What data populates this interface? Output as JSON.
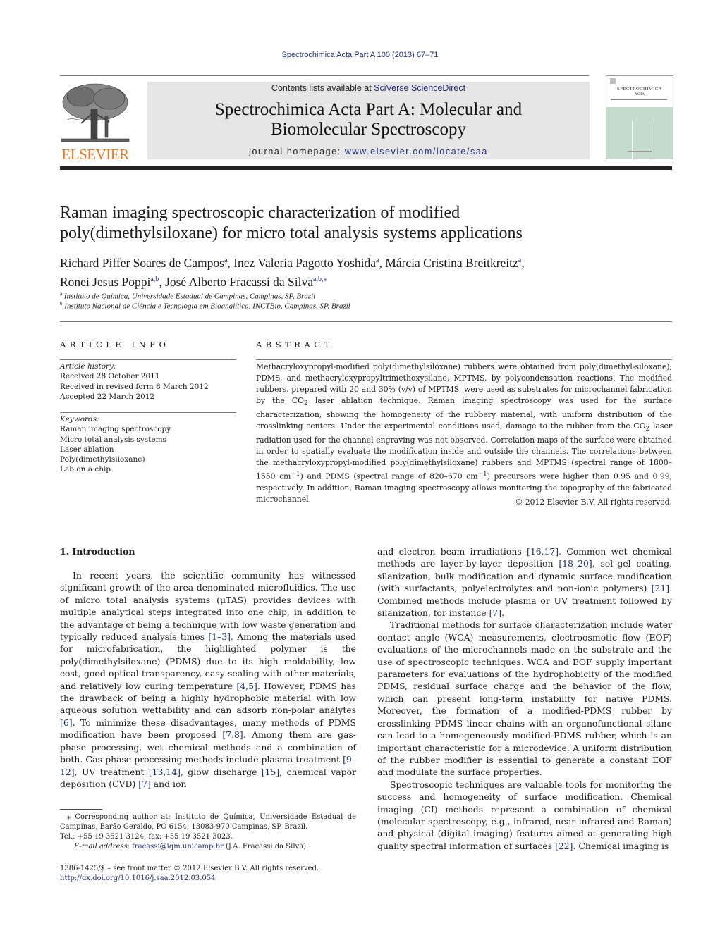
{
  "header": {
    "running_head": "Spectrochimica Acta Part A 100 (2013) 67–71",
    "contents_prefix": "Contents lists available at ",
    "contents_link": "SciVerse ScienceDirect",
    "journal_title_line1": "Spectrochimica Acta Part A: Molecular and",
    "journal_title_line2": "Biomolecular Spectroscopy",
    "homepage_prefix": "journal homepage: ",
    "homepage_link": "www.elsevier.com/locate/saa",
    "publisher_logo_text": "ELSEVIER",
    "cover_title": "SPECTROCHIMICA",
    "cover_subtitle": "ACTA",
    "publisher_color": "#e87722",
    "link_color": "#1f2d7a",
    "cover_color": "#c4dccb"
  },
  "article": {
    "title_line1": "Raman imaging spectroscopic characterization of modified",
    "title_line2": "poly(dimethylsiloxane) for micro total analysis systems applications",
    "authors": [
      {
        "name": "Richard Piffer Soares de Campos",
        "affil": "a",
        "sep": ", "
      },
      {
        "name": "Inez Valeria Pagotto Yoshida",
        "affil": "a",
        "sep": ", "
      },
      {
        "name": "Márcia Cristina Breitkreitz",
        "affil": "a",
        "sep": ","
      },
      {
        "name": "Ronei Jesus Poppi",
        "affil": "a,b",
        "sep": ", "
      },
      {
        "name": "José Alberto Fracassi da Silva",
        "affil": "a,b,⁎",
        "sep": ""
      }
    ],
    "affiliations": [
      {
        "mark": "a",
        "text": "Instituto de Química, Universidade Estadual de Campinas, Campinas, SP, Brazil"
      },
      {
        "mark": "b",
        "text": "Instituto Nacional de Ciência e Tecnologia em Bioanalítica, INCTBio, Campinas, SP, Brazil"
      }
    ]
  },
  "article_info": {
    "heading": "ARTICLE INFO",
    "history_label": "Article history:",
    "history": [
      "Received 28 October 2011",
      "Received in revised form 8 March 2012",
      "Accepted 22 March 2012"
    ],
    "keywords_label": "Keywords:",
    "keywords": [
      "Raman imaging spectroscopy",
      "Micro total analysis systems",
      "Laser ablation",
      "Poly(dimethylsiloxane)",
      "Lab on a chip"
    ]
  },
  "abstract": {
    "heading": "ABSTRACT",
    "p1": "Methacryloxypropyl-modified poly(dimethylsiloxane) rubbers were obtained from poly(dimethyl-siloxane), PDMS, and methacryloxypropyltrimethoxysilane, MPTMS, by polycondensation reactions. The modified rubbers, prepared with 20 and 30% (v/v) of MPTMS, were used as substrates for microchannel fabrication by the CO",
    "p2": " laser ablation technique. Raman imaging spectroscopy was used for the surface characterization, showing the homogeneity of the rubbery material, with uniform distribution of the crosslinking centers. Under the experimental conditions used, damage to the rubber from the CO",
    "p3": " laser radiation used for the channel engraving was not observed. Correlation maps of the surface were obtained in order to spatially evaluate the modification inside and outside the channels. The correlations between the methacryloxypropyl-modified poly(dimethylsiloxane) rubbers and MPTMS (spectral range of 1800–1550 cm",
    "p4": ") and PDMS (spectral range of 820–670 cm",
    "p5": ") precursors were higher than 0.95 and 0.99, respectively. In addition, Raman imaging spectroscopy allows monitoring the topography of the fabricated microchannel.",
    "sub2": "2",
    "sup_minus1": "−1",
    "copyright": "© 2012 Elsevier B.V. All rights reserved."
  },
  "intro": {
    "heading": "1.  Introduction",
    "left_p1_a": "In recent years, the scientific community has witnessed significant growth of the area denominated microfluidics. The use of micro total analysis systems (μTAS) provides devices with multiple analytical steps integrated into one chip, in addition to the advantage of being a technique with low waste generation and typically reduced analysis times ",
    "ref_1_3": "[1–3]",
    "left_p1_b": ". Among the materials used for microfabrication, the highlighted polymer is the poly(dimethylsiloxane) (PDMS) due to its high moldability, low cost, good optical transparency, easy sealing with other materials, and relatively low curing temperature ",
    "ref_4_5": "[4,5]",
    "left_p1_c": ". However, PDMS has the drawback of being a highly hydrophobic material with low aqueous solution wettability and can adsorb non-polar analytes ",
    "ref_6": "[6]",
    "left_p1_d": ". To minimize these disadvantages, many methods of PDMS modification have been proposed ",
    "ref_7_8": "[7,8]",
    "left_p1_e": ". Among them are gas-phase processing, wet chemical methods and a combination of both. Gas-phase processing methods include plasma treatment ",
    "ref_9_12": "[9–12]",
    "left_p1_f": ", UV treatment ",
    "ref_13_14": "[13,14]",
    "left_p1_g": ", glow discharge ",
    "ref_15": "[15]",
    "left_p1_h": ", chemical vapor deposition (CVD) ",
    "ref_7": "[7]",
    "left_p1_i": " and ion",
    "right_p1_a": "and electron beam irradiations ",
    "ref_16_17": "[16,17]",
    "right_p1_b": ". Common wet chemical methods are layer-by-layer deposition ",
    "ref_18_20": "[18–20]",
    "right_p1_c": ", sol–gel coating, silanization, bulk modification and dynamic surface modification (with surfactants, polyelectrolytes and non-ionic polymers) ",
    "ref_21": "[21]",
    "right_p1_d": ". Combined methods include plasma or UV treatment followed by silanization, for instance ",
    "ref_7b": "[7]",
    "right_p1_e": ".",
    "right_p2": "Traditional methods for surface characterization include water contact angle (WCA) measurements, electroosmotic flow (EOF) evaluations of the microchannels made on the substrate and the use of spectroscopic techniques. WCA and EOF supply important parameters for evaluations of the hydrophobicity of the modified PDMS, residual surface charge and the behavior of the flow, which can present long-term instability for native PDMS. Moreover, the formation of a modified-PDMS rubber by crosslinking PDMS linear chains with an organofunctional silane can lead to a homogeneously modified-PDMS rubber, which is an important characteristic for a microdevice. A uniform distribution of the rubber modifier is essential to generate a constant EOF and modulate the surface properties.",
    "right_p3_a": "Spectroscopic techniques are valuable tools for monitoring the success and homogeneity of surface modification. Chemical imaging (CI) methods represent a combination of chemical (molecular spectroscopy, e.g., infrared, near infrared and Raman) and physical (digital imaging) features aimed at generating high quality spectral information of surfaces ",
    "ref_22": "[22]",
    "right_p3_b": ". Chemical imaging is"
  },
  "footnotes": {
    "corresponding": "⁎  Corresponding author at: Instituto de Química, Universidade Estadual de Campinas, Barão Geraldo, PO 6154, 13083-970 Campinas, SP, Brazil.",
    "tel": "Tel.: +55 19 3521 3124; fax: +55 19 3521 3023.",
    "email_label": "E-mail address: ",
    "email": "fracassi@iqm.unicamp.br",
    "email_name": " (J.A. Fracassi da Silva).",
    "issn": "1386-1425/$ – see front matter © 2012 Elsevier B.V. All rights reserved.",
    "doi": "http://dx.doi.org/10.1016/j.saa.2012.03.054"
  }
}
